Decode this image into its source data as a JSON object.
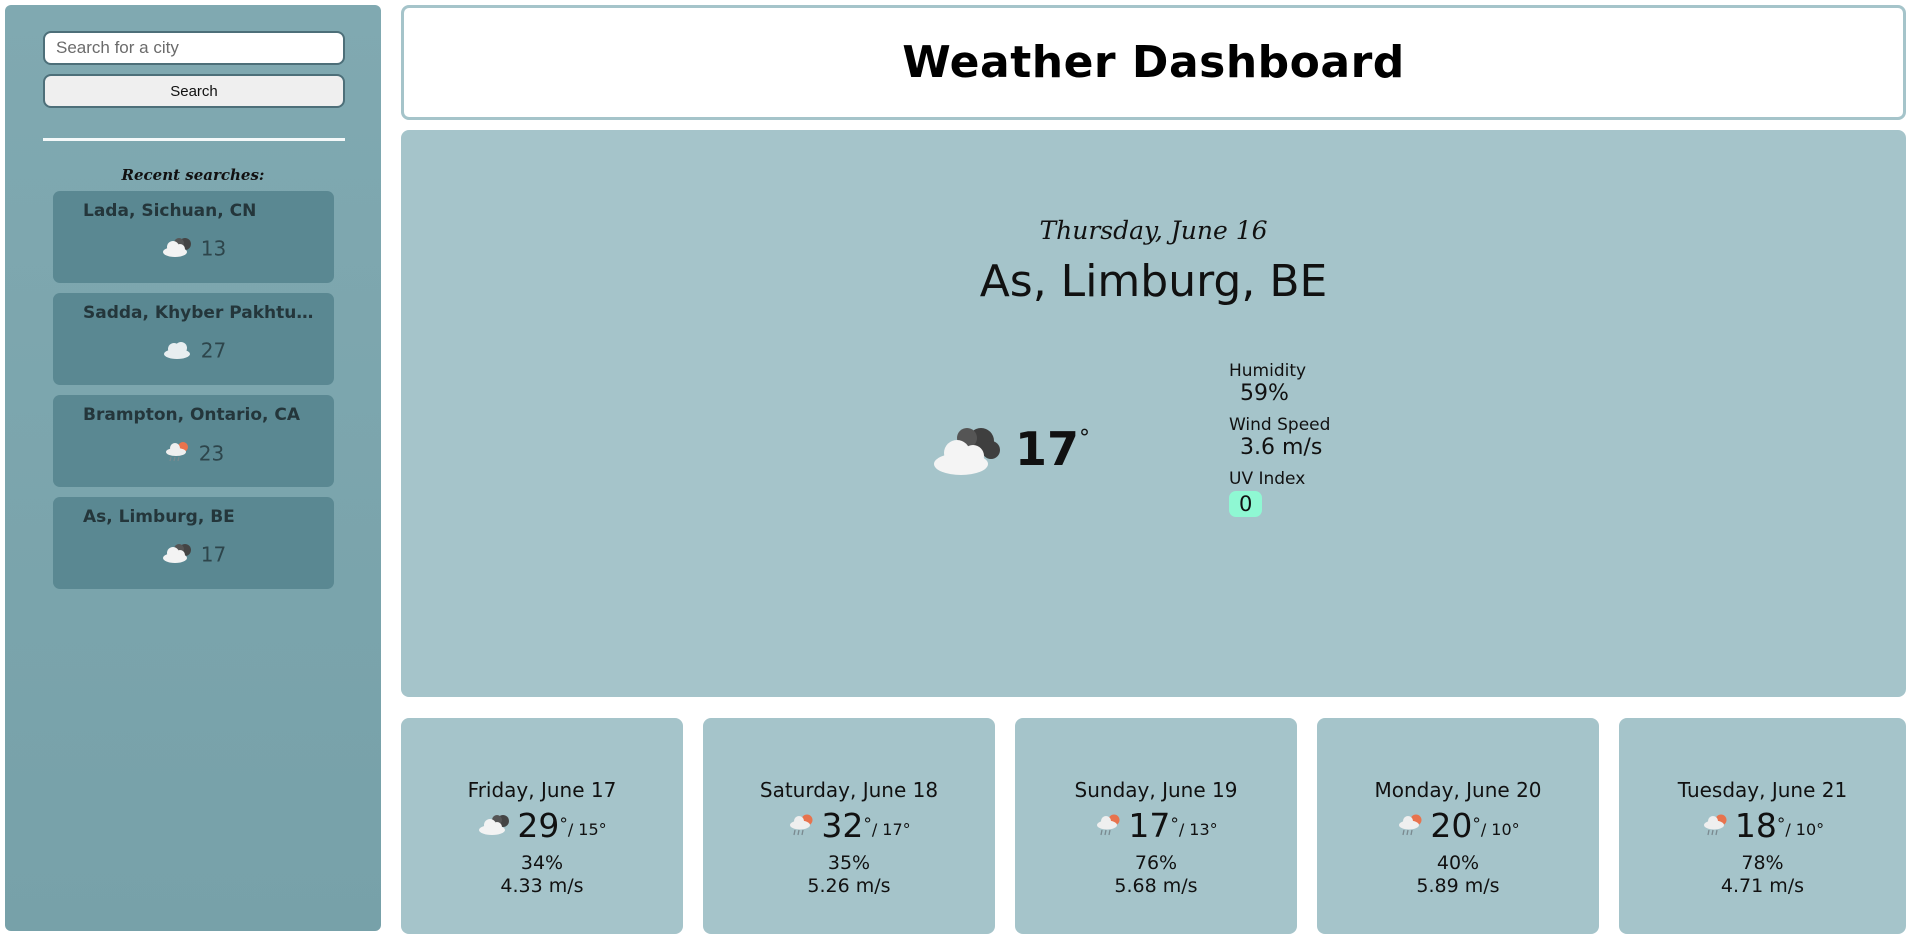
{
  "app": {
    "title": "Weather Dashboard"
  },
  "search": {
    "placeholder": "Search for a city",
    "button_label": "Search"
  },
  "recent": {
    "title": "Recent searches:",
    "items": [
      {
        "city": "Lada, Sichuan, CN",
        "temp": "13",
        "icon": "cloudy-icon"
      },
      {
        "city": "Sadda, Khyber Pakhtunkhwa, PK",
        "temp": "27",
        "icon": "cloud-icon"
      },
      {
        "city": "Brampton, Ontario, CA",
        "temp": "23",
        "icon": "sun-rain-icon"
      },
      {
        "city": "As, Limburg, BE",
        "temp": "17",
        "icon": "cloudy-icon"
      }
    ]
  },
  "current": {
    "date": "Thursday, June 16",
    "city": "As, Limburg, BE",
    "temp": "17",
    "degree": "°",
    "icon": "cloudy-icon",
    "humidity_label": "Humidity",
    "humidity": "59%",
    "wind_label": "Wind Speed",
    "wind": "3.6 m/s",
    "uv_label": "UV Index",
    "uv": "0",
    "uv_color": "#8ff8d3"
  },
  "forecast": [
    {
      "date": "Friday, June 17",
      "high": "29",
      "low": "/ 15°",
      "humidity": "34%",
      "wind": "4.33 m/s",
      "icon": "cloudy-icon"
    },
    {
      "date": "Saturday, June 18",
      "high": "32",
      "low": "/ 17°",
      "humidity": "35%",
      "wind": "5.26 m/s",
      "icon": "sun-rain-icon"
    },
    {
      "date": "Sunday, June 19",
      "high": "17",
      "low": "/ 13°",
      "humidity": "76%",
      "wind": "5.68 m/s",
      "icon": "sun-rain-icon"
    },
    {
      "date": "Monday, June 20",
      "high": "20",
      "low": "/ 10°",
      "humidity": "40%",
      "wind": "5.89 m/s",
      "icon": "sun-rain-icon"
    },
    {
      "date": "Tuesday, June 21",
      "high": "18",
      "low": "/ 10°",
      "humidity": "78%",
      "wind": "4.71 m/s",
      "icon": "sun-rain-icon"
    }
  ],
  "colors": {
    "sidebar": "#7ba5ad",
    "recent_card": "#5a8892",
    "panel": "#a5c4ca",
    "uv_low": "#8ff8d3"
  }
}
